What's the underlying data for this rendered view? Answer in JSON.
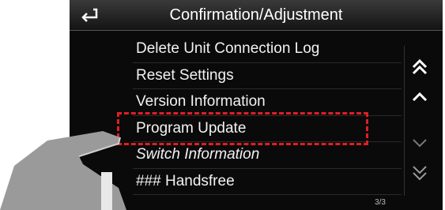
{
  "header": {
    "title": "Confirmation/Adjustment",
    "back_icon": "back-arrow-icon"
  },
  "menu": {
    "items": [
      {
        "label": "Delete Unit Connection Log"
      },
      {
        "label": "Reset Settings"
      },
      {
        "label": "Version Information"
      },
      {
        "label": "Program Update"
      },
      {
        "label": "Switch Information"
      },
      {
        "label": "### Handsfree"
      }
    ]
  },
  "scroll": {
    "icons": [
      "double-chevron-up-icon",
      "chevron-up-icon",
      "chevron-down-icon",
      "double-chevron-down-icon"
    ],
    "page_indicator": "3/3"
  },
  "highlight_color": "#e01e24"
}
